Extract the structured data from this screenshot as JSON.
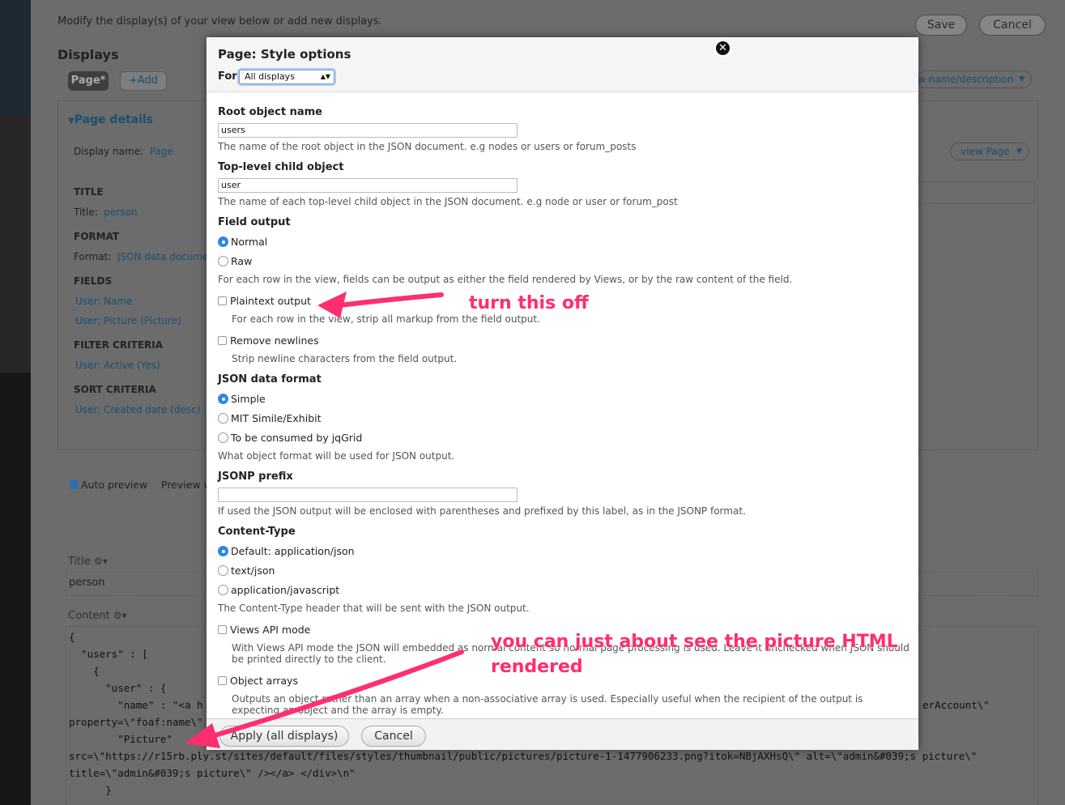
{
  "background": {
    "intro": "Modify the display(s) of your view below or add new displays.",
    "save_label": "Save",
    "cancel_label": "Cancel",
    "displays_heading": "Displays",
    "tab_page": "Page*",
    "add_label": "+Add",
    "edit_name_label": "w name/description",
    "page_details_label": "Page details",
    "display_name_label": "Display name:",
    "display_name_value": "Page",
    "view_page_label": "view Page",
    "title_heading": "TITLE",
    "title_label": "Title:",
    "title_value": "person",
    "format_heading": "FORMAT",
    "format_label": "Format:",
    "format_value": "JSON data documer",
    "fields_heading": "FIELDS",
    "field_1": "User: Name",
    "field_2": "User: Picture (Picture)",
    "filter_heading": "FILTER CRITERIA",
    "filter_1": "User: Active (Yes)",
    "sort_heading": "SORT CRITERIA",
    "sort_1": "User: Created date (desc)",
    "auto_preview": "Auto preview",
    "preview_with": "Preview w",
    "preview_title_label": "Title",
    "preview_title_value": "person",
    "preview_content_label": "Content",
    "code_lines": [
      "{",
      "  \"users\" : [",
      "    {",
      "      \"user\" : {",
      "        \"name\" : \"<a h",
      "property=\\\"foaf:name\\\"",
      "        \"Picture\"",
      "src=\\\"https://r15rb.ply.st/sites/default/files/styles/thumbnail/public/pictures/picture-1-1477906233.png?itok=NBjAXHsQ\\\" alt=\\\"admin&#039;s picture\\\"",
      "title=\\\"admin&#039;s picture\\\" /></a> </div>\\n\"",
      "      }"
    ],
    "code_right_fragment": "erAccount\\\""
  },
  "modal": {
    "title": "Page: Style options",
    "for_label": "For",
    "for_value": "All displays",
    "root_object_label": "Root object name",
    "root_object_value": "users",
    "root_object_desc": "The name of the root object in the JSON document. e.g nodes or users or forum_posts",
    "child_object_label": "Top-level child object",
    "child_object_value": "user",
    "child_object_desc": "The name of each top-level child object in the JSON document. e.g node or user or forum_post",
    "field_output_label": "Field output",
    "field_output_options": [
      "Normal",
      "Raw"
    ],
    "field_output_desc": "For each row in the view, fields can be output as either the field rendered by Views, or by the raw content of the field.",
    "plaintext_label": "Plaintext output",
    "plaintext_desc": "For each row in the view, strip all markup from the field output.",
    "remove_newlines_label": "Remove newlines",
    "remove_newlines_desc": "Strip newline characters from the field output.",
    "json_format_label": "JSON data format",
    "json_format_options": [
      "Simple",
      "MIT Simile/Exhibit",
      "To be consumed by jqGrid"
    ],
    "json_format_desc": "What object format will be used for JSON output.",
    "jsonp_label": "JSONP prefix",
    "jsonp_value": "",
    "jsonp_desc": "If used the JSON output will be enclosed with parentheses and prefixed by this label, as in the JSONP format.",
    "content_type_label": "Content-Type",
    "content_type_options": [
      "Default: application/json",
      "text/json",
      "application/javascript"
    ],
    "content_type_desc": "The Content-Type header that will be sent with the JSON output.",
    "views_api_label": "Views API mode",
    "views_api_desc": "With Views API mode the JSON will embedded as normal content so normal page processing is used. Leave it unchecked when JSON should be printed directly to the client.",
    "object_arrays_label": "Object arrays",
    "object_arrays_desc": "Outputs an object rather than an array when a non-associative array is used. Especially useful when the recipient of the output is expecting an object and the array is empty.",
    "apply_label": "Apply (all displays)",
    "cancel_label": "Cancel"
  },
  "annotations": {
    "note_1": "turn this off",
    "note_2_line1": "you can just about see the picture HTML",
    "note_2_line2": "rendered",
    "color": "#ff2e6e"
  }
}
